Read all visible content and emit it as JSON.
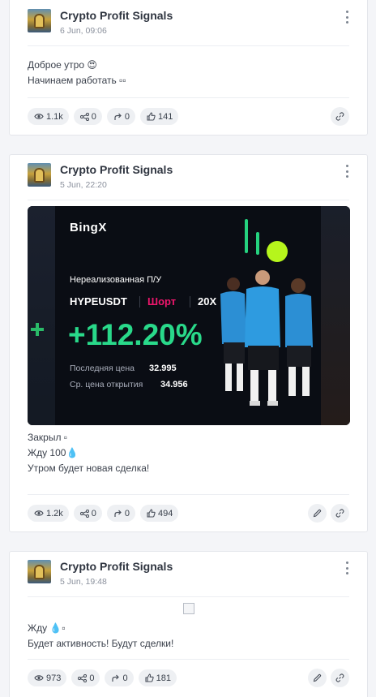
{
  "posts": [
    {
      "channel": "Crypto Profit Signals",
      "date": "6 Jun, 09:06",
      "lines": [
        "Доброе утро 😍",
        "Начинаем работать ▫▫"
      ],
      "stats": {
        "views": "1.1k",
        "shares": "0",
        "forwards": "0",
        "likes": "141"
      }
    },
    {
      "channel": "Crypto Profit Signals",
      "date": "5 Jun, 22:20",
      "banner": {
        "brand": "BingX",
        "title": "Нереализованная П/У",
        "pair": "HYPEUSDT",
        "side": "Шорт",
        "leverage": "20X",
        "roi": "+112.20%",
        "last_price_label": "Последняя цена",
        "last_price": "32.995",
        "open_price_label": "Ср. цена открытия",
        "open_price": "34.956",
        "colors": {
          "roi": "#29d98a",
          "short": "#f0166d",
          "accent": "#b6f51c"
        }
      },
      "lines": [
        "Закрыл ▫",
        "Жду 100💧",
        "Утром будет новая сделка!"
      ],
      "stats": {
        "views": "1.2k",
        "shares": "0",
        "forwards": "0",
        "likes": "494"
      }
    },
    {
      "channel": "Crypto Profit Signals",
      "date": "5 Jun, 19:48",
      "lines": [
        "Жду 💧▫",
        "Будет активность! Будут сделки!"
      ],
      "stats": {
        "views": "973",
        "shares": "0",
        "forwards": "0",
        "likes": "181"
      }
    }
  ],
  "icons": {
    "views": "eye-icon",
    "shares": "share-icon",
    "forwards": "forward-icon",
    "likes": "thumbs-up-icon",
    "edit": "pencil-icon",
    "link": "link-icon",
    "menu": "more-vertical-icon"
  }
}
